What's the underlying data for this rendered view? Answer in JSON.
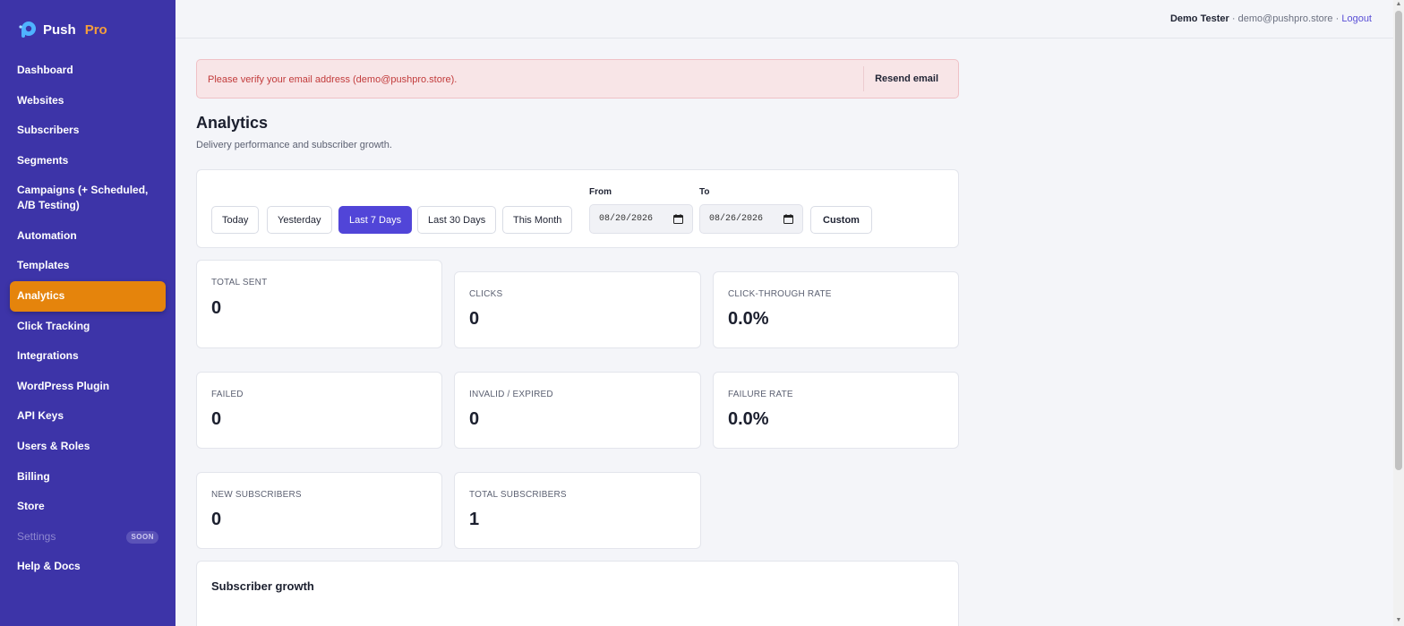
{
  "brand": {
    "name": "Push",
    "suffix": "Pro"
  },
  "sidebar": {
    "items": [
      {
        "label": "Dashboard"
      },
      {
        "label": "Websites"
      },
      {
        "label": "Subscribers"
      },
      {
        "label": "Segments"
      },
      {
        "label": "Campaigns (+ Scheduled, A/B Testing)"
      },
      {
        "label": "Automation"
      },
      {
        "label": "Templates"
      },
      {
        "label": "Analytics",
        "active": true
      },
      {
        "label": "Click Tracking"
      },
      {
        "label": "Integrations"
      },
      {
        "label": "WordPress Plugin"
      },
      {
        "label": "API Keys"
      },
      {
        "label": "Users & Roles"
      },
      {
        "label": "Billing"
      },
      {
        "label": "Store"
      },
      {
        "label": "Settings",
        "badge": "SOON",
        "disabled": true
      },
      {
        "label": "Help & Docs"
      }
    ]
  },
  "header": {
    "user_name": "Demo Tester",
    "separator": "·",
    "email": "demo@pushpro.store",
    "logout_label": "Logout"
  },
  "alert": {
    "message": "Please verify your email address (demo@pushpro.store).",
    "button_label": "Resend email"
  },
  "page": {
    "title": "Analytics",
    "subtitle": "Delivery performance and subscriber growth."
  },
  "filters": {
    "ranges": [
      {
        "label": "Today"
      },
      {
        "label": "Yesterday"
      },
      {
        "label": "Last 7 Days",
        "active": true
      },
      {
        "label": "Last 30 Days"
      },
      {
        "label": "This Month"
      }
    ],
    "from_label": "From",
    "from_value": "08/20/2026",
    "to_label": "To",
    "to_value": "08/26/2026",
    "custom_label": "Custom"
  },
  "stats": [
    {
      "label": "TOTAL SENT",
      "value": "0"
    },
    {
      "label": "CLICKS",
      "value": "0"
    },
    {
      "label": "CLICK-THROUGH RATE",
      "value": "0.0%"
    },
    {
      "label": "FAILED",
      "value": "0"
    },
    {
      "label": "INVALID / EXPIRED",
      "value": "0"
    },
    {
      "label": "FAILURE RATE",
      "value": "0.0%"
    },
    {
      "label": "NEW SUBSCRIBERS",
      "value": "0"
    },
    {
      "label": "TOTAL SUBSCRIBERS",
      "value": "1"
    }
  ],
  "growth": {
    "title": "Subscriber growth"
  },
  "colors": {
    "sidebar_bg": "#3d34a8",
    "active_nav": "#e5840c",
    "accent": "#5145d8",
    "brand_pro": "#f59e3b",
    "alert_text": "#c23b3b"
  }
}
